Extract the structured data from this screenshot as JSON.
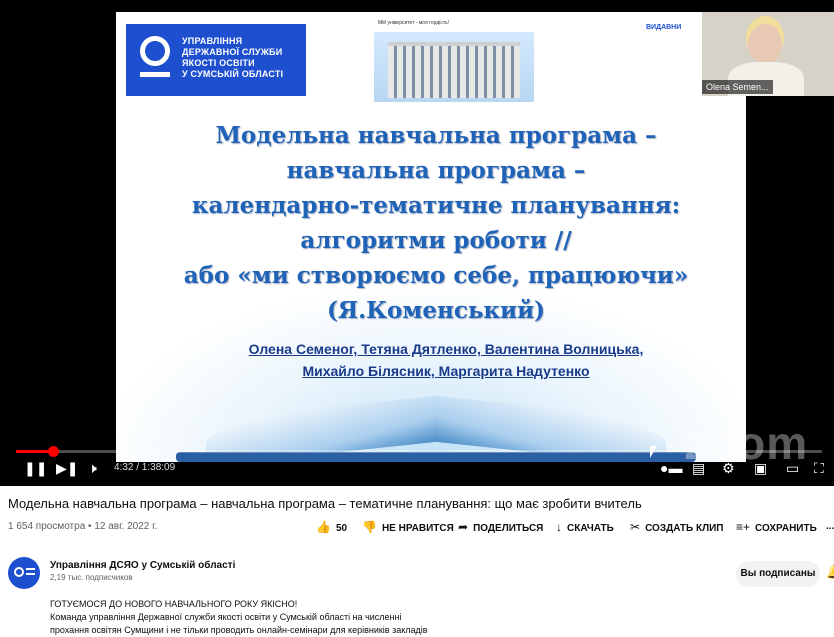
{
  "slide": {
    "logo_lines": [
      "УПРАВЛІННЯ",
      "ДЕРЖАВНОЇ СЛУЖБИ",
      "ЯКОСТІ ОСВІТИ",
      "У СУМСЬКІЙ ОБЛАСТІ"
    ],
    "building_caption": "Мій університет - моя гордість!",
    "publisher": "ВИДАВНИ",
    "title_lines": [
      "Модельна навчальна програма –",
      "навчальна програма –",
      "календарно-тематичне планування:",
      "алгоритми роботи //",
      "або «ми створюємо себе, працюючи»",
      "(Я.Коменський)"
    ],
    "authors_lines": [
      "Олена Семеног, Тетяна Дятленко, Валентина Волницька,",
      "Михайло Білясник,  Маргарита Надутенко"
    ],
    "watermark": "zoom",
    "camera_label": "Olena Semen..."
  },
  "player": {
    "time": "4:32 / 1:38:09",
    "progress": 0.046,
    "icons": {
      "play_pause": "pause-icon",
      "next": "next-icon",
      "volume": "volume-icon",
      "autoplay": "autoplay-toggle-icon",
      "subtitles": "subtitles-icon",
      "settings": "gear-icon",
      "miniplayer": "miniplayer-icon",
      "theater": "theater-icon",
      "fullscreen": "fullscreen-icon"
    }
  },
  "video": {
    "title": "Модельна навчальна програма – навчальна програма – тематичне планування: що має зробити вчитель",
    "meta": "1 654 просмотра • 12 авг. 2022 г.",
    "actions": {
      "like_count": "50",
      "dislike": "НЕ НРАВИТСЯ",
      "share": "ПОДЕЛИТЬСЯ",
      "download": "СКАЧАТЬ",
      "clip": "СОЗДАТЬ КЛИП",
      "save": "СОХРАНИТЬ",
      "more": "..."
    }
  },
  "channel": {
    "name": "Управління ДСЯО у Сумській області",
    "subs": "2,19 тыс. подписчиков",
    "subscribe_label": "Вы подписаны"
  },
  "description": {
    "lines": [
      "ГОТУЄМОСЯ ДО НОВОГО НАВЧАЛЬНОГО РОКУ ЯКІСНО!",
      "Команда управління Державної служби якості освіти у Сумській області  на численні",
      "прохання освітян Сумщини і не тільки проводить онлайн-семінари для керівників закладів"
    ]
  },
  "colors": {
    "accent_red": "#ff0000",
    "brand_blue": "#1d4fcf",
    "title_blue": "#1f63b8"
  }
}
